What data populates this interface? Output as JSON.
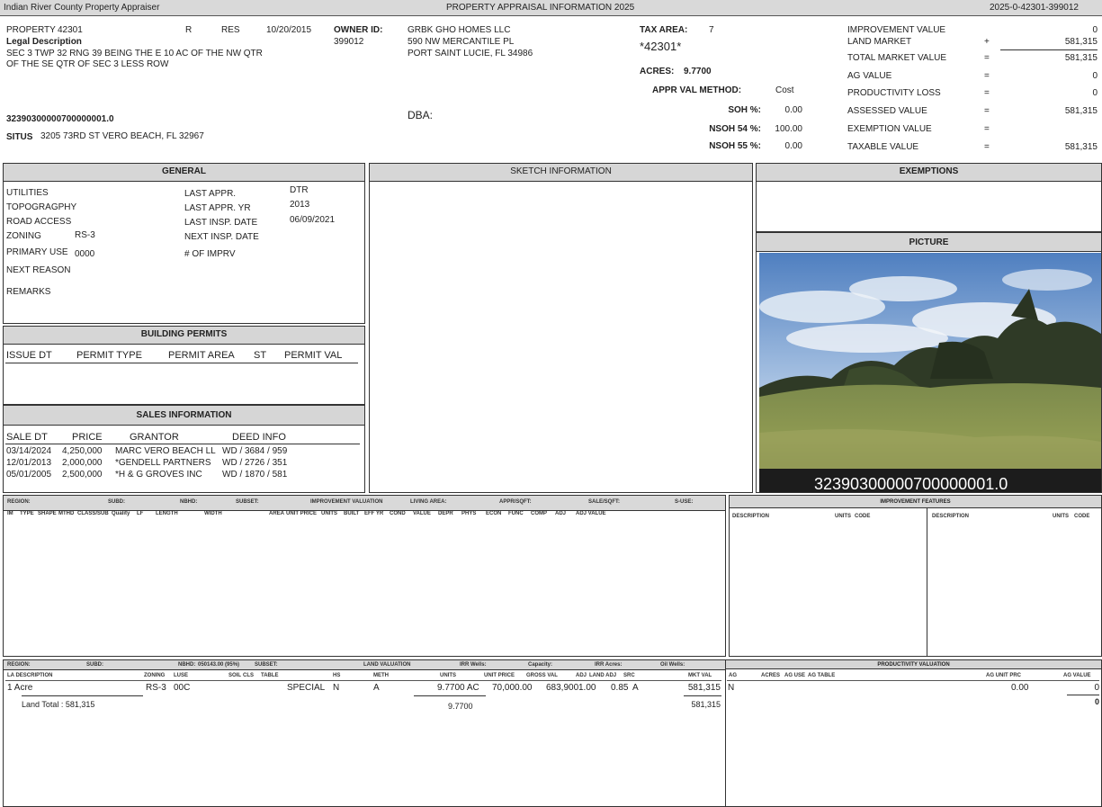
{
  "topbar": {
    "left": "Indian River County Property Appraiser",
    "center": "PROPERTY APPRAISAL INFORMATION 2025",
    "right": "2025-0-42301-399012"
  },
  "property": {
    "label": "PROPERTY",
    "number": "42301",
    "type_code": "R",
    "class": "RES",
    "date": "10/20/2015",
    "legal_label": "Legal Description",
    "legal_line1": "SEC 3 TWP 32 RNG 39 BEING THE E 10 AC OF THE NW QTR",
    "legal_line2": "OF THE SE QTR OF SEC 3 LESS ROW",
    "parcel_id": "32390300000700000001.0",
    "situs_label": "SITUS",
    "situs": "3205 73RD ST  VERO BEACH, FL 32967"
  },
  "owner": {
    "label": "OWNER ID:",
    "id": "399012",
    "name": "GRBK GHO HOMES LLC",
    "address1": "590 NW MERCANTILE PL",
    "address2": "PORT SAINT LUCIE, FL 34986",
    "dba_label": "DBA:"
  },
  "tax": {
    "area_label": "TAX AREA:",
    "area": "7",
    "code": "*42301*",
    "acres_label": "ACRES:",
    "acres": "9.7700",
    "method_label": "APPR VAL METHOD:",
    "method": "Cost",
    "soh_label": "SOH %:",
    "soh": "0.00",
    "nsoh54_label": "NSOH 54 %:",
    "nsoh54": "100.00",
    "nsoh55_label": "NSOH 55 %:",
    "nsoh55": "0.00"
  },
  "values": [
    {
      "label": "IMPROVEMENT VALUE",
      "op": "",
      "value": "0"
    },
    {
      "label": "LAND MARKET",
      "op": "+",
      "value": "581,315"
    },
    {
      "label": "TOTAL MARKET VALUE",
      "op": "=",
      "value": "581,315"
    },
    {
      "label": "AG VALUE",
      "op": "=",
      "value": "0"
    },
    {
      "label": "PRODUCTIVITY LOSS",
      "op": "=",
      "value": "0"
    },
    {
      "label": "ASSESSED VALUE",
      "op": "=",
      "value": "581,315"
    },
    {
      "label": "EXEMPTION VALUE",
      "op": "=",
      "value": ""
    },
    {
      "label": "TAXABLE VALUE",
      "op": "=",
      "value": "581,315"
    }
  ],
  "general": {
    "title": "GENERAL",
    "utilities": "UTILITIES",
    "topography": "TOPOGRAGPHY",
    "road_access": "ROAD ACCESS",
    "zoning_label": "ZONING",
    "zoning": "RS-3",
    "primary_use_label": "PRIMARY USE",
    "primary_use": "0000",
    "next_reason": "NEXT REASON",
    "remarks": "REMARKS",
    "last_appr_label": "LAST APPR.",
    "last_appr": "DTR",
    "last_appr_yr_label": "LAST APPR. YR",
    "last_appr_yr": "2013",
    "last_insp_label": "LAST INSP. DATE",
    "last_insp": "06/09/2021",
    "next_insp_label": "NEXT INSP. DATE",
    "num_imprv_label": "# OF IMPRV"
  },
  "permits": {
    "title": "BUILDING PERMITS",
    "headers": [
      "ISSUE DT",
      "PERMIT TYPE",
      "PERMIT AREA",
      "ST",
      "PERMIT VAL"
    ]
  },
  "sales": {
    "title": "SALES INFORMATION",
    "headers": [
      "SALE DT",
      "PRICE",
      "GRANTOR",
      "DEED INFO"
    ],
    "rows": [
      {
        "date": "03/14/2024",
        "price": "4,250,000",
        "grantor": "MARC VERO BEACH LL",
        "deed": "WD / 3684 / 959"
      },
      {
        "date": "12/01/2013",
        "price": "2,000,000",
        "grantor": "*GENDELL PARTNERS",
        "deed": "WD / 2726 / 351"
      },
      {
        "date": "05/01/2005",
        "price": "2,500,000",
        "grantor": "*H & G GROVES INC",
        "deed": "WD / 1870 / 581"
      }
    ]
  },
  "sketch": {
    "title": "SKETCH INFORMATION"
  },
  "exemptions": {
    "title": "EXEMPTIONS"
  },
  "picture": {
    "title": "PICTURE",
    "caption": "32390300000700000001.0"
  },
  "improvement": {
    "top_labels": [
      "REGION:",
      "SUBD:",
      "NBHD:",
      "SUBSET:",
      "IMPROVEMENT VALUATION",
      "LIVING AREA:",
      "APPR/SQFT:",
      "SALE/SQFT:",
      "S-USE:"
    ],
    "col_headers": [
      "IM",
      "TYPE",
      "SHAPE",
      "MTHD",
      "CLASS/SUB",
      "Quality",
      "LF",
      "LENGTH",
      "WIDTH",
      "AREA",
      "UNIT PRICE",
      "UNITS",
      "BUILT",
      "EFF YR",
      "COND",
      "VALUE",
      "DEPR",
      "PHYS",
      "ECON",
      "FUNC",
      "COMP",
      "ADJ",
      "ADJ VALUE"
    ]
  },
  "features": {
    "title": "IMPROVEMENT FEATURES",
    "headers": [
      "DESCRIPTION",
      "UNITS",
      "CODE",
      "DESCRIPTION",
      "UNITS",
      "CODE"
    ]
  },
  "land": {
    "top_labels": [
      "REGION:",
      "SUBD:",
      "NBHD:",
      "050143.00 (95%)",
      "SUBSET:",
      "LAND VALUATION",
      "IRR Wells:",
      "Capacity:",
      "IRR Acres:",
      "Oil Wells:"
    ],
    "col_headers": [
      "LA DESCRIPTION",
      "ZONING",
      "LUSE",
      "SOIL",
      "CLS",
      "TABLE",
      "HS",
      "METH",
      "UNITS",
      "UNIT PRICE",
      "GROSS VAL",
      "ADJ",
      "LAND ADJ",
      "SRC",
      "MKT VAL"
    ],
    "row": {
      "desc": "1 Acre",
      "zoning": "RS-3",
      "luse": "00C",
      "table": "SPECIAL",
      "hs": "N",
      "meth": "A",
      "units": "9.7700 AC",
      "unit_price": "70,000.00",
      "gross": "683,900",
      "adj": "1.00",
      "land_adj": "0.85",
      "src": "A",
      "mkt": "581,315"
    },
    "total_label": "Land Total : 581,315",
    "total_units": "9.7700",
    "total_mkt": "581,315"
  },
  "productivity": {
    "title": "PRODUCTIVITY VALUATION",
    "headers": [
      "AG",
      "ACRES",
      "AG USE",
      "AG TABLE",
      "AG UNIT PRC",
      "AG VALUE"
    ],
    "row": {
      "ag": "N",
      "unit_prc": "0.00",
      "value": "0"
    },
    "total": "0"
  }
}
